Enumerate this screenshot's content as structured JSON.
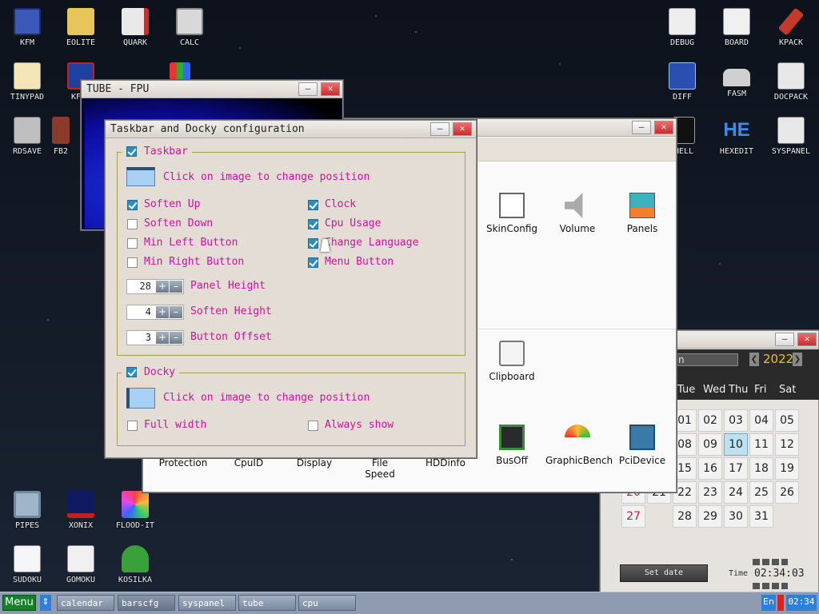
{
  "desktop_icons": [
    {
      "label": "KFM",
      "icon": "floppy-icon"
    },
    {
      "label": "EOLITE",
      "icon": "folder-icon"
    },
    {
      "label": "QUARK",
      "icon": "book-icon"
    },
    {
      "label": "CALC",
      "icon": "calculator-icon"
    },
    {
      "label": "TINYPAD",
      "icon": "notepad-icon"
    },
    {
      "label": "RDSAVE",
      "icon": "drive-icon"
    },
    {
      "label": "FB2",
      "icon": "reader-icon"
    },
    {
      "label": "DEBUG",
      "icon": "bug-icon"
    },
    {
      "label": "BOARD",
      "icon": "board-icon"
    },
    {
      "label": "KPACK",
      "icon": "hammer-icon"
    },
    {
      "label": "DIFF",
      "icon": "diff-icon"
    },
    {
      "label": "FASM",
      "icon": "anvil-icon"
    },
    {
      "label": "DOCPACK",
      "icon": "cabinet-icon"
    },
    {
      "label": "HEXEDIT",
      "icon": "hex-icon"
    },
    {
      "label": "SYSPANEL",
      "icon": "sliders-icon"
    },
    {
      "label": "HELL",
      "icon": "shell-icon"
    },
    {
      "label": "PIPES",
      "icon": "pipes-icon"
    },
    {
      "label": "XONIX",
      "icon": "xonix-icon"
    },
    {
      "label": "FLOOD-IT",
      "icon": "flood-icon"
    },
    {
      "label": "SUDOKU",
      "icon": "sudoku-icon"
    },
    {
      "label": "GOMOKU",
      "icon": "gomoku-icon"
    },
    {
      "label": "KOSILKA",
      "icon": "mower-icon"
    }
  ],
  "hexedit_glyph": "HE",
  "kf_partial": "KF",
  "tube": {
    "title": "TUBE - FPU",
    "min": "–",
    "close": "✕"
  },
  "cfg": {
    "title": "Taskbar and Docky configuration",
    "min": "–",
    "close": "✕",
    "taskbar_label": "Taskbar",
    "taskbar_hint": "Click on image to change position",
    "soften_up": "Soften Up",
    "soften_down": "Soften Down",
    "min_left": "Min Left Button",
    "min_right": "Min Right Button",
    "clock": "Clock",
    "cpu_usage": "Cpu Usage",
    "change_language": "Change Language",
    "menu_button": "Menu Button",
    "panel_height_val": "28",
    "panel_height": "Panel Height",
    "soften_height_val": "4",
    "soften_height": "Soften Height",
    "button_offset_val": "3",
    "button_offset": "Button Offset",
    "plus": "+",
    "minus": "–",
    "docky_label": "Docky",
    "docky_hint": "Click on image to change position",
    "full_width": "Full width",
    "always_show": "Always show"
  },
  "syspanel": {
    "min": "–",
    "close": "✕",
    "row1": [
      "SkinConfig",
      "Volume",
      "Panels"
    ],
    "row2": [
      "Clipboard"
    ],
    "row3": [
      "Protection",
      "CpuID",
      "Display",
      "File Speed",
      "HDDinfo",
      "BusOff",
      "GraphicBench",
      "PciDevice"
    ]
  },
  "calendar": {
    "min": "–",
    "close": "✕",
    "month_partial": "n",
    "year": "2022",
    "prev": "❮",
    "next": "❯",
    "weekdays": [
      "Tue",
      "Wed",
      "Thu",
      "Fri",
      "Sat"
    ],
    "rows": [
      [
        "01",
        "02",
        "03",
        "04",
        "05"
      ],
      [
        "08",
        "09",
        "10",
        "11",
        "12"
      ],
      [
        "15",
        "16",
        "17",
        "18",
        "19"
      ],
      [
        "22",
        "23",
        "24",
        "25",
        "26"
      ],
      [
        "27",
        "28",
        "29",
        "30",
        "31"
      ]
    ],
    "partial_left": [
      "20",
      "21"
    ],
    "today": "10",
    "set_date": "Set date",
    "time_label": "Time",
    "time": "02:34:03"
  },
  "taskbar": {
    "menu": "Menu",
    "arrow": "⇕",
    "items": [
      "calendar",
      "barscfg",
      "syspanel",
      "tube",
      "cpu"
    ],
    "lang": "En",
    "clock": "02:34"
  },
  "colors": {
    "accent": "#c9169a",
    "group_border": "#a6a04c",
    "check": "#2a8fc0",
    "taskbar": "#8e9bb0",
    "today": "#bfe0f0",
    "sunday": "#c0203a"
  }
}
